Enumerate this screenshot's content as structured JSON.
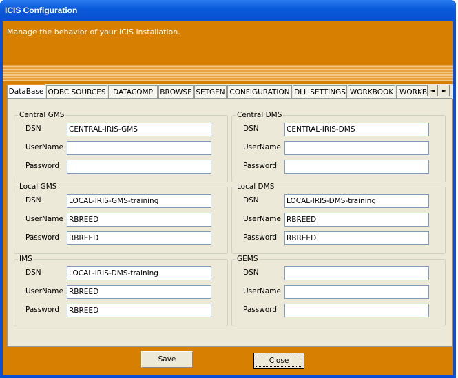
{
  "window": {
    "title": "ICIS Configuration"
  },
  "header": {
    "text": "Manage the behavior of your ICIS installation."
  },
  "tabs": [
    "DataBase",
    "ODBC SOURCES",
    "DATACOMP",
    "BROWSE",
    "SETGEN",
    "CONFIGURATION",
    "DLL SETTINGS",
    "WORKBOOK",
    "WORKBOOK"
  ],
  "tab_scroll": {
    "left_icon": "arrow-left-icon",
    "right_icon": "arrow-right-icon"
  },
  "labels": {
    "dsn": "DSN",
    "username": "UserName",
    "password": "Password"
  },
  "groups": [
    {
      "title": "Central GMS",
      "dsn": "CENTRAL-IRIS-GMS",
      "username": "",
      "password": ""
    },
    {
      "title": "Central DMS",
      "dsn": "CENTRAL-IRIS-DMS",
      "username": "",
      "password": ""
    },
    {
      "title": "Local GMS",
      "dsn": "LOCAL-IRIS-GMS-training",
      "username": "RBREED",
      "password": "RBREED"
    },
    {
      "title": "Local DMS",
      "dsn": "LOCAL-IRIS-DMS-training",
      "username": "RBREED",
      "password": "RBREED"
    },
    {
      "title": "IMS",
      "dsn": "LOCAL-IRIS-DMS-training",
      "username": "RBREED",
      "password": "RBREED"
    },
    {
      "title": "GEMS",
      "dsn": "",
      "username": "",
      "password": ""
    }
  ],
  "buttons": {
    "save": "Save",
    "close": "Close"
  },
  "colors": {
    "accent": "#D67F00",
    "titlebar": "#0A5ADB",
    "panel": "#ECE9D8"
  }
}
